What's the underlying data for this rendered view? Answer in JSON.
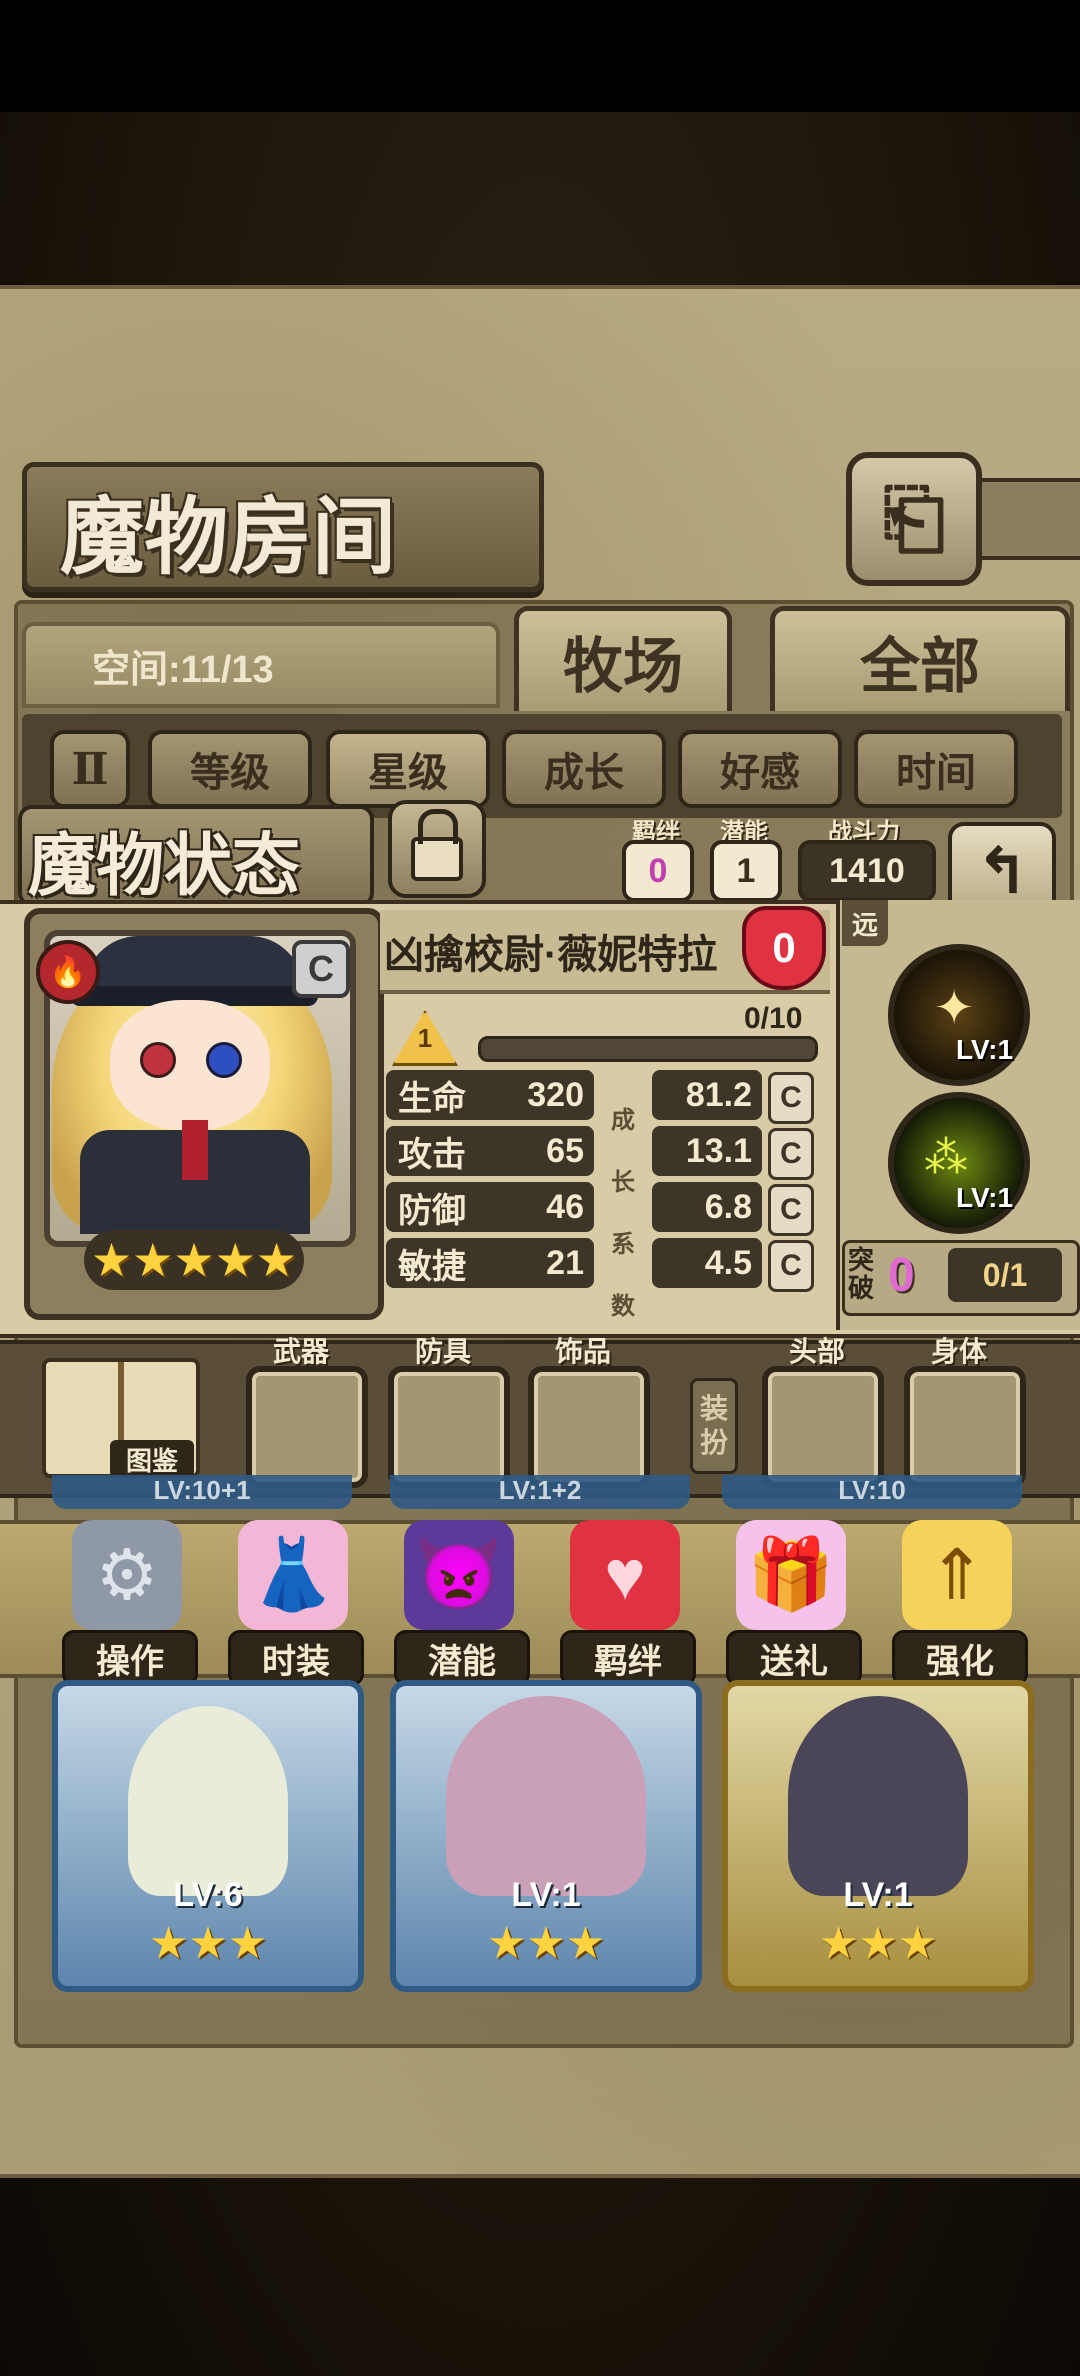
{
  "header": {
    "title": "魔物房间",
    "back_icon": "return-icon"
  },
  "space": {
    "label": "空间:11/13"
  },
  "tabs": [
    {
      "label": "牧场"
    },
    {
      "label": "全部"
    }
  ],
  "filters": [
    {
      "label": "Ⅱ",
      "icon": "pause-icon"
    },
    {
      "label": "等级"
    },
    {
      "label": "星级",
      "selected": true
    },
    {
      "label": "成长"
    },
    {
      "label": "好感"
    },
    {
      "label": "时间"
    }
  ],
  "status": {
    "title": "魔物状态",
    "bond_label": "羁绊",
    "bond_value": "0",
    "potential_label": "潜能",
    "potential_value": "1",
    "power_label": "战斗力",
    "power_value": "1410",
    "name": "凶擒校尉·薇妮特拉",
    "affection": "0",
    "level": "1",
    "exp": "0/10",
    "exp_fraction": 0,
    "grade": "C",
    "stars": "★★★★★",
    "range": "远",
    "growth_label": [
      "成",
      "长",
      "系",
      "数"
    ],
    "stats": [
      {
        "label": "生命",
        "value": "320",
        "growth": "81.2",
        "grade": "C"
      },
      {
        "label": "攻击",
        "value": "65",
        "growth": "13.1",
        "grade": "C"
      },
      {
        "label": "防御",
        "value": "46",
        "growth": "6.8",
        "grade": "C"
      },
      {
        "label": "敏捷",
        "value": "21",
        "growth": "4.5",
        "grade": "C"
      }
    ],
    "skills": [
      {
        "level": "LV:1"
      },
      {
        "level": "LV:1"
      }
    ],
    "breakthrough_label": "突破",
    "breakthrough_count": "0",
    "breakthrough_progress": "0/1"
  },
  "equipment": {
    "book_label": "图鉴",
    "slots": [
      {
        "label": "武器"
      },
      {
        "label": "防具"
      },
      {
        "label": "饰品"
      },
      {
        "label": "头部"
      },
      {
        "label": "身体"
      }
    ],
    "dress_tag": [
      "装",
      "扮"
    ]
  },
  "actions": [
    {
      "label": "操作",
      "icon": "gear-icon"
    },
    {
      "label": "时装",
      "icon": "outfit-icon"
    },
    {
      "label": "潜能",
      "icon": "potential-icon"
    },
    {
      "label": "羁绊",
      "icon": "hearts-icon"
    },
    {
      "label": "送礼",
      "icon": "gift-icon"
    },
    {
      "label": "强化",
      "icon": "upgrade-arrows-icon"
    }
  ],
  "cards": [
    {
      "level": "LV:6",
      "stars": "★★★",
      "strip": "LV:10+1"
    },
    {
      "level": "LV:1",
      "stars": "★★★",
      "strip": "LV:1+2"
    },
    {
      "level": "LV:1",
      "stars": "★★★",
      "strip": "LV:10"
    }
  ]
}
